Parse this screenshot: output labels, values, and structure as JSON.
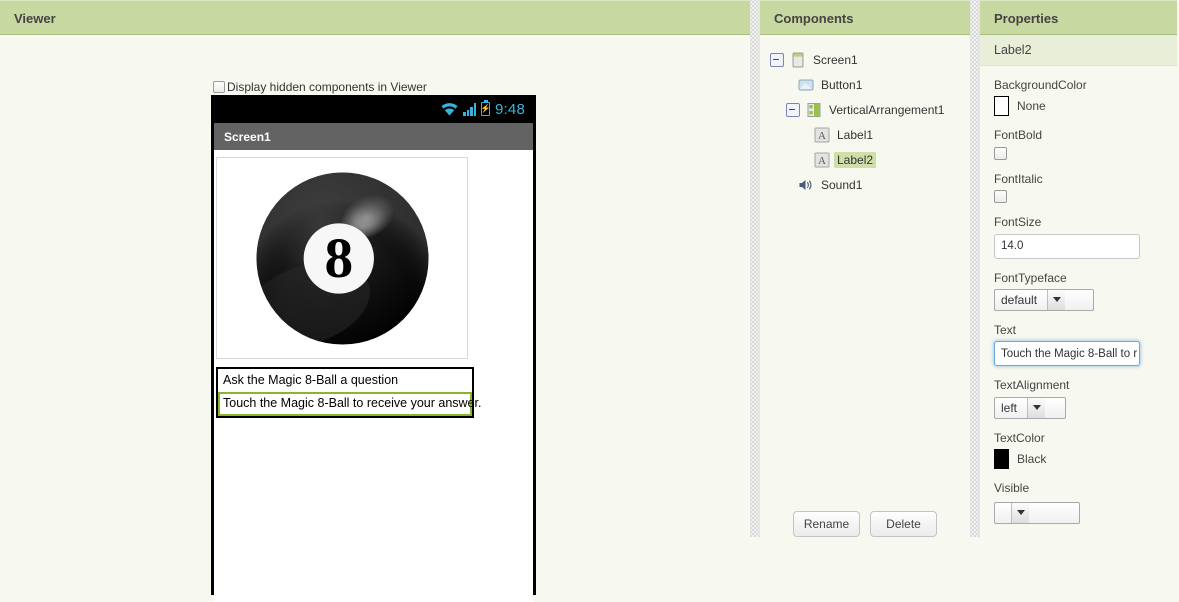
{
  "viewer": {
    "title": "Viewer",
    "hidden_components_label": "Display hidden components in Viewer",
    "phone": {
      "status_time": "9:48",
      "status_icons": [
        "wifi-icon",
        "signal-icon",
        "battery-icon"
      ],
      "title_bar": "Screen1",
      "image_component": "magic-8-ball-image",
      "labels": [
        {
          "name": "Label1",
          "text": "Ask the Magic 8-Ball a question",
          "selected": false
        },
        {
          "name": "Label2",
          "text": "Touch the Magic 8-Ball to receive your answer.",
          "selected": true
        }
      ]
    }
  },
  "components": {
    "title": "Components",
    "tree": [
      {
        "label": "Screen1",
        "icon": "screen-icon",
        "depth": 0,
        "expander": "collapse",
        "selected": false
      },
      {
        "label": "Button1",
        "icon": "button-icon",
        "depth": 1,
        "expander": "none",
        "selected": false
      },
      {
        "label": "VerticalArrangement1",
        "icon": "vertical-arrangement-icon",
        "depth": 1,
        "expander": "collapse",
        "selected": false
      },
      {
        "label": "Label1",
        "icon": "label-icon",
        "depth": 2,
        "expander": "none",
        "selected": false
      },
      {
        "label": "Label2",
        "icon": "label-icon",
        "depth": 2,
        "expander": "none",
        "selected": true
      },
      {
        "label": "Sound1",
        "icon": "sound-icon",
        "depth": 1,
        "expander": "none",
        "selected": false
      }
    ],
    "rename_label": "Rename",
    "delete_label": "Delete"
  },
  "properties": {
    "title": "Properties",
    "selected_component": "Label2",
    "items": [
      {
        "name": "BackgroundColor",
        "kind": "color",
        "value": "None",
        "swatch": "#ffffff"
      },
      {
        "name": "FontBold",
        "kind": "checkbox",
        "value": "",
        "checked": false
      },
      {
        "name": "FontItalic",
        "kind": "checkbox",
        "value": "",
        "checked": false
      },
      {
        "name": "FontSize",
        "kind": "text",
        "value": "14.0"
      },
      {
        "name": "FontTypeface",
        "kind": "select",
        "value": "default"
      },
      {
        "name": "Text",
        "kind": "text",
        "value": "Touch the Magic 8-Ball to r",
        "focused": true
      },
      {
        "name": "TextAlignment",
        "kind": "select",
        "value": "left"
      },
      {
        "name": "TextColor",
        "kind": "color",
        "value": "Black",
        "swatch": "#000000"
      },
      {
        "name": "Visible",
        "kind": "select",
        "value": ""
      }
    ]
  },
  "colors": {
    "panel_header": "#c7d8a0",
    "panel_bg": "#f7f9f0",
    "selection_highlight": "#cfdfa8",
    "selection_border": "#8ab52e",
    "status_icon": "#36b5e0",
    "title_bar": "#636363"
  }
}
